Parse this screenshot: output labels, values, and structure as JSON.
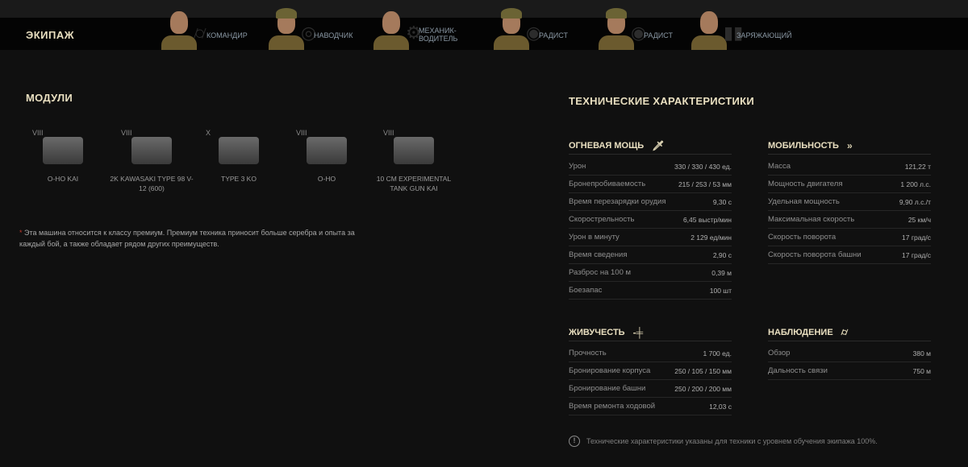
{
  "crew": {
    "title": "ЭКИПАЖ",
    "members": [
      {
        "role": "КОМАНДИР",
        "icon": "binoculars-icon",
        "cap": false
      },
      {
        "role": "НАВОДЧИК",
        "icon": "crosshair-icon",
        "cap": true
      },
      {
        "role": "МЕХАНИК-ВОДИТЕЛЬ",
        "icon": "gear-icon",
        "cap": false
      },
      {
        "role": "РАДИСТ",
        "icon": "radio-icon",
        "cap": true
      },
      {
        "role": "РАДИСТ",
        "icon": "radio-icon",
        "cap": true
      },
      {
        "role": "ЗАРЯЖАЮЩИЙ",
        "icon": "shells-icon",
        "cap": false
      }
    ]
  },
  "modules": {
    "title": "МОДУЛИ",
    "items": [
      {
        "tier": "VIII",
        "name": "O-HO KAI",
        "type": "tracks"
      },
      {
        "tier": "VIII",
        "name": "2K KAWASAKI TYPE 98 V-12 (600)",
        "type": "engine"
      },
      {
        "tier": "X",
        "name": "TYPE 3 KO",
        "type": "radio"
      },
      {
        "tier": "VIII",
        "name": "O-HO",
        "type": "turret"
      },
      {
        "tier": "VIII",
        "name": "10 CM EXPERIMENTAL TANK GUN KAI",
        "type": "gun"
      }
    ]
  },
  "premium_note": {
    "marker": "*",
    "text": "Эта машина относится к классу премиум. Премиум техника приносит больше серебра и опыта за каждый бой, а также обладает рядом других преимуществ."
  },
  "specs": {
    "title": "ТЕХНИЧЕСКИЕ ХАРАКТЕРИСТИКИ",
    "firepower": {
      "title": "ОГНЕВАЯ МОЩЬ",
      "icon": "sword-icon",
      "rows": [
        {
          "label": "Урон",
          "value": "330 / 330 / 430 ед."
        },
        {
          "label": "Бронепробиваемость",
          "value": "215 / 253 / 53 мм"
        },
        {
          "label": "Время перезарядки орудия",
          "value": "9,30 с"
        },
        {
          "label": "Скорострельность",
          "value": "6,45 выстр/мин"
        },
        {
          "label": "Урон в минуту",
          "value": "2 129 ед/мин"
        },
        {
          "label": "Время сведения",
          "value": "2,90 с"
        },
        {
          "label": "Разброс на 100 м",
          "value": "0,39 м"
        },
        {
          "label": "Боезапас",
          "value": "100 шт"
        }
      ]
    },
    "mobility": {
      "title": "МОБИЛЬНОСТЬ",
      "icon": "chevrons-icon",
      "rows": [
        {
          "label": "Масса",
          "value": "121,22 т"
        },
        {
          "label": "Мощность двигателя",
          "value": "1 200 л.с."
        },
        {
          "label": "Удельная мощность",
          "value": "9,90 л.с./т"
        },
        {
          "label": "Максимальная скорость",
          "value": "25 км/ч"
        },
        {
          "label": "Скорость поворота",
          "value": "17 град/с"
        },
        {
          "label": "Скорость поворота башни",
          "value": "17 град/с"
        }
      ]
    },
    "survivability": {
      "title": "ЖИВУЧЕСТЬ",
      "icon": "armor-icon",
      "rows": [
        {
          "label": "Прочность",
          "value": "1 700 ед."
        },
        {
          "label": "Бронирование корпуса",
          "value": "250 / 105 / 150 мм"
        },
        {
          "label": "Бронирование башни",
          "value": "250 / 200 / 200 мм"
        },
        {
          "label": "Время ремонта ходовой",
          "value": "12,03 с"
        }
      ]
    },
    "observation": {
      "title": "НАБЛЮДЕНИЕ",
      "icon": "binoculars-icon",
      "rows": [
        {
          "label": "Обзор",
          "value": "380 м"
        },
        {
          "label": "Дальность связи",
          "value": "750 м"
        }
      ]
    },
    "footnote": "Технические характеристики указаны для техники с уровнем обучения экипажа 100%."
  }
}
